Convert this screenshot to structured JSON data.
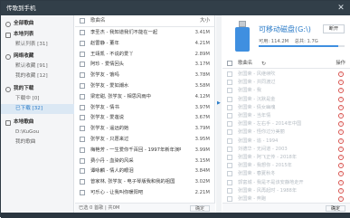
{
  "window": {
    "title": "传歌到手机",
    "close_glyph": "✕"
  },
  "sidebar": {
    "groups": [
      {
        "label": "全部歌曲",
        "items": []
      },
      {
        "label": "本地列表",
        "items": [
          {
            "label": "默认列表 [31]"
          }
        ]
      },
      {
        "label": "网络收藏",
        "items": [
          {
            "label": "默认收藏 [91]"
          },
          {
            "label": "我的收藏 [12]"
          }
        ]
      },
      {
        "label": "我的下载",
        "items": [
          {
            "label": "下载中 [0]"
          },
          {
            "label": "已下载 [32]",
            "selected": true
          }
        ]
      },
      {
        "label": "本地歌曲",
        "items": [
          {
            "label": "D:\\KuGou"
          },
          {
            "label": "我的歌曲"
          }
        ]
      }
    ]
  },
  "songs": {
    "header": {
      "name": "歌曲名",
      "size": "大小"
    },
    "rows": [
      {
        "name": "李圣杰 - 我知道我们不能在一起",
        "size": "3.41M"
      },
      {
        "name": "赵雷静 - 董年",
        "size": "4.21M"
      },
      {
        "name": "王靖凯 - 不说的爱丫",
        "size": "2.89M"
      },
      {
        "name": "阿珍 - 爱情回头",
        "size": "3.17M"
      },
      {
        "name": "张学友 - 饿吗",
        "size": "3.78M"
      },
      {
        "name": "张学友 - 爱如潮水",
        "size": "3.58M"
      },
      {
        "name": "梁宏甜, 张学友 - 相思风雨中",
        "size": "4.12M"
      },
      {
        "name": "张学友 - 情书",
        "size": "3.97M"
      },
      {
        "name": "张学友 - 爱莲说",
        "size": "3.67M"
      },
      {
        "name": "张学友 - 遥远的她",
        "size": "3.79M"
      },
      {
        "name": "张学友 - 只愿来过",
        "size": "3.95M"
      },
      {
        "name": "梅艳芳 - 一生爱你千百回 - 1997年新年演唱会",
        "size": "3.99M"
      },
      {
        "name": "费小丹 - 血染的风采",
        "size": "3.15M"
      },
      {
        "name": "谭咏麟 - 情人的眼泪",
        "size": "3.84M"
      },
      {
        "name": "曾家林, 张学友 - 电子琴版我和我的祖国",
        "size": "3.02M"
      },
      {
        "name": "可乐心 - 让我叫你暖阳吧",
        "size": "2.21M"
      }
    ],
    "footer": {
      "status": "已选 0 首歌",
      "size": "共0M",
      "button": "确定"
    }
  },
  "transfer_arrow": "▶",
  "device": {
    "name": "可移动磁盘(G:\\)",
    "button": "断开",
    "stats": {
      "capacity": "可用: 114.2M",
      "total": "总共: 1.7G"
    },
    "usage_fraction": 0.93,
    "header": {
      "name": "歌曲名",
      "action": "操作"
    },
    "rows": [
      "张国荣 - 风继续吹",
      "张国荣 - 共同渡过",
      "张国荣 - 我",
      "张国荣 - 沉默是金",
      "张国荣 - 倩女幽魂",
      "张国荣 - 当年情",
      "张国荣 - 左右手 - 2014年中国",
      "张国荣 - 怪你过分美丽",
      "张国荣 - 追 - 1994",
      "刘德华 - 无间道 - 2003",
      "张国荣 - 阿飞正传 - 2018年",
      "张国荣 - 我想你 - 2015年",
      "张国荣 - 春夏秋冬",
      "郭富城 - 我是不是该安静地走开",
      "张国荣 - 风再起时 - 1988年",
      "张国荣 - 奔跑"
    ],
    "footer": {
      "button": "确定"
    }
  }
}
